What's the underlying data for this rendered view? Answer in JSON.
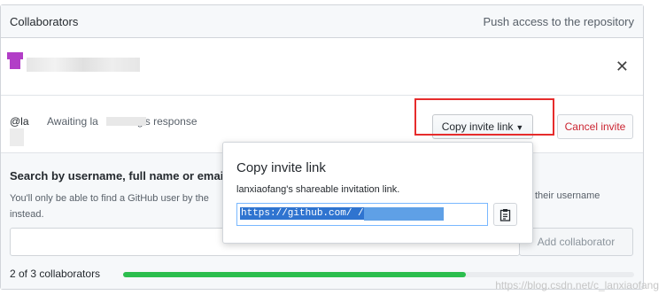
{
  "header": {
    "title": "Collaborators",
    "hint": "Push access to the repository"
  },
  "collaborator": {
    "close_symbol": "✕"
  },
  "invite": {
    "user_prefix": "@la",
    "status_text": "Awaiting la",
    "status_suffix": "g's response",
    "copy_button_label": "Copy invite link",
    "cancel_button_label": "Cancel invite"
  },
  "search": {
    "title": "Search by username, full name or emai",
    "description": "You'll only be able to find a GitHub user by the",
    "description_tail": "their username",
    "description_line2": "instead.",
    "input_placeholder": "",
    "add_button_label": "Add collaborator"
  },
  "usage": {
    "count_text": "2 of 3 collaborators",
    "progress": 0.67
  },
  "popover": {
    "title": "Copy invite link",
    "description": "lanxiaofang's shareable invitation link.",
    "link_value": "https://github.com/                         /invit"
  },
  "watermark": "https://blog.csdn.net/c_lanxiaofang",
  "colors": {
    "accent": "#2cbe4e",
    "danger": "#cb2431",
    "highlight_box": "#e62c2c"
  }
}
